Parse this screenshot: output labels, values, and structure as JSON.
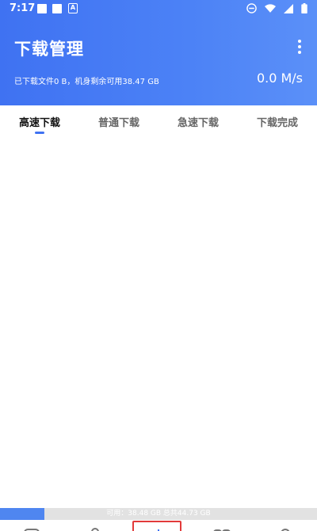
{
  "status_bar": {
    "time": "7:17",
    "a_badge": "A"
  },
  "header": {
    "title": "下载管理",
    "subtitle": "已下载文件0 B，机身剩余可用38.47 GB",
    "speed": "0.0 M/s"
  },
  "tabs": [
    {
      "label": "高速下载",
      "active": true
    },
    {
      "label": "普通下载",
      "active": false
    },
    {
      "label": "急速下载",
      "active": false
    },
    {
      "label": "下载完成",
      "active": false
    }
  ],
  "storage": {
    "text": "可用：38.48 GB 总共44.73 GB",
    "used_fraction": 0.14
  },
  "bottom_nav": [
    {
      "icon": "message-icon"
    },
    {
      "icon": "person-icon"
    },
    {
      "icon": "add-icon"
    },
    {
      "icon": "grid-icon"
    },
    {
      "icon": "user-icon"
    }
  ],
  "colors": {
    "accent": "#3f72f2",
    "highlight": "#e23a3a"
  }
}
